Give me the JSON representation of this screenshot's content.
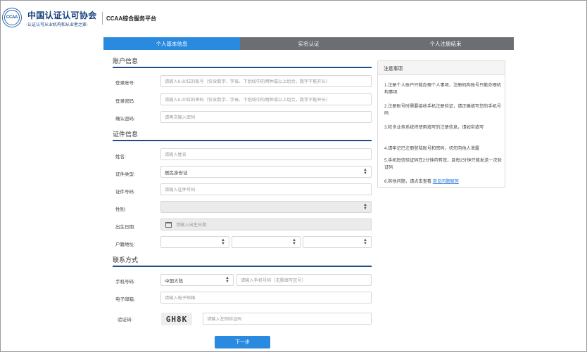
{
  "header": {
    "logo_text": "CCAA",
    "org_name": "中国认证认可协会",
    "slogan": "-认证认可从业机构和从业者之家-",
    "platform_title": "CCAA综合服务平台"
  },
  "steps": [
    "个人基本信息",
    "实名认证",
    "个人注册结束"
  ],
  "sections": {
    "account": "账户信息",
    "certificate": "证件信息",
    "contact": "联系方式"
  },
  "account": {
    "username_label": "登录账号:",
    "username_placeholder": "请输入6-20位的账号（仅含数字、字母、下划线中的两种或以上组合，数字不能开头）",
    "password_label": "登录密码:",
    "password_placeholder": "请输入8-20位的密码（仅含数字、字母、下划线中的两种或以上组合，数字不能开头）",
    "confirm_label": "确认密码:",
    "confirm_placeholder": "请再次输入密码"
  },
  "certificate": {
    "name_label": "姓名:",
    "name_placeholder": "请输入姓名",
    "type_label": "证件类型:",
    "type_value": "居民身份证",
    "number_label": "证件号码:",
    "number_placeholder": "请输入证件号码",
    "gender_label": "性别:",
    "gender_value": "",
    "birth_label": "出生日期:",
    "birth_placeholder": "请输入出生日期",
    "hukou_label": "户籍地址:"
  },
  "contact": {
    "phone_label": "手机号码:",
    "region_value": "中国大陆",
    "phone_placeholder": "请输入手机号码（无需填写区号）",
    "email_label": "电子邮箱:",
    "email_placeholder": "请输入电子邮箱",
    "captcha_label": "验证码:",
    "captcha_text": "GH8K",
    "captcha_placeholder": "请输入左侧验证码"
  },
  "next_button": "下一步",
  "notes": {
    "title": "注意事项",
    "items": [
      "1.注册个人账户只能办理个人事项，注册机构账号只能办理机构事项",
      "2.注册账号时需要接收手机注册验证，请正确填写您的手机号码",
      "3.较多业务系统将使用填写的注册信息，请如实填写",
      "4.请牢记已注册登陆账号和密码，切勿向他人泄露",
      "5.手机短信验证码在2分钟内有效，且每2分钟只能发送一次验证码",
      "6.其他问题，请点击查看"
    ],
    "link": "常见问题解答"
  },
  "colors": {
    "primary": "#2a8ae0",
    "step_inactive": "#6b6e72",
    "section_line": "#1d4e86",
    "brand_text": "#153f7a"
  }
}
